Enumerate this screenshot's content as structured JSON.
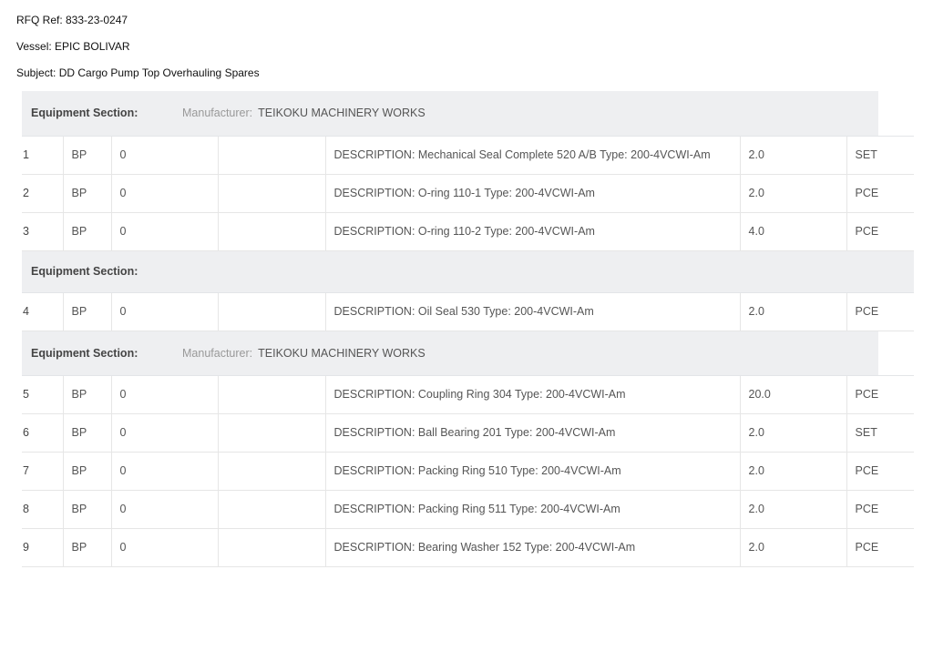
{
  "header": {
    "rfq": "RFQ Ref: 833-23-0247",
    "vessel": "Vessel: EPIC BOLIVAR",
    "subject": "Subject: DD Cargo Pump Top Overhauling Spares"
  },
  "section_label": "Equipment Section:",
  "manufacturer_label": "Manufacturer:",
  "sections": [
    {
      "manufacturer": "TEIKOKU MACHINERY WORKS",
      "items": [
        {
          "no": "1",
          "code": "BP",
          "qty0": "0",
          "blank": "",
          "description": "DESCRIPTION: Mechanical Seal Complete 520 A/B Type: 200-4VCWI-Am",
          "quantity": "2.0",
          "unit": "SET"
        },
        {
          "no": "2",
          "code": "BP",
          "qty0": "0",
          "blank": "",
          "description": "DESCRIPTION: O-ring 110-1 Type: 200-4VCWI-Am",
          "quantity": "2.0",
          "unit": "PCE"
        },
        {
          "no": "3",
          "code": "BP",
          "qty0": "0",
          "blank": "",
          "description": "DESCRIPTION: O-ring 110-2 Type: 200-4VCWI-Am",
          "quantity": "4.0",
          "unit": "PCE"
        }
      ]
    },
    {
      "manufacturer": "",
      "items": [
        {
          "no": "4",
          "code": "BP",
          "qty0": "0",
          "blank": "",
          "description": "DESCRIPTION: Oil Seal 530 Type: 200-4VCWI-Am",
          "quantity": "2.0",
          "unit": "PCE"
        }
      ]
    },
    {
      "manufacturer": "TEIKOKU MACHINERY WORKS",
      "items": [
        {
          "no": "5",
          "code": "BP",
          "qty0": "0",
          "blank": "",
          "description": "DESCRIPTION: Coupling Ring 304 Type: 200-4VCWI-Am",
          "quantity": "20.0",
          "unit": "PCE"
        },
        {
          "no": "6",
          "code": "BP",
          "qty0": "0",
          "blank": "",
          "description": "DESCRIPTION: Ball Bearing 201 Type: 200-4VCWI-Am",
          "quantity": "2.0",
          "unit": "SET"
        },
        {
          "no": "7",
          "code": "BP",
          "qty0": "0",
          "blank": "",
          "description": "DESCRIPTION: Packing Ring 510 Type: 200-4VCWI-Am",
          "quantity": "2.0",
          "unit": "PCE"
        },
        {
          "no": "8",
          "code": "BP",
          "qty0": "0",
          "blank": "",
          "description": "DESCRIPTION: Packing Ring 511 Type: 200-4VCWI-Am",
          "quantity": "2.0",
          "unit": "PCE"
        },
        {
          "no": "9",
          "code": "BP",
          "qty0": "0",
          "blank": "",
          "description": "DESCRIPTION: Bearing Washer 152 Type: 200-4VCWI-Am",
          "quantity": "2.0",
          "unit": "PCE"
        }
      ]
    }
  ]
}
